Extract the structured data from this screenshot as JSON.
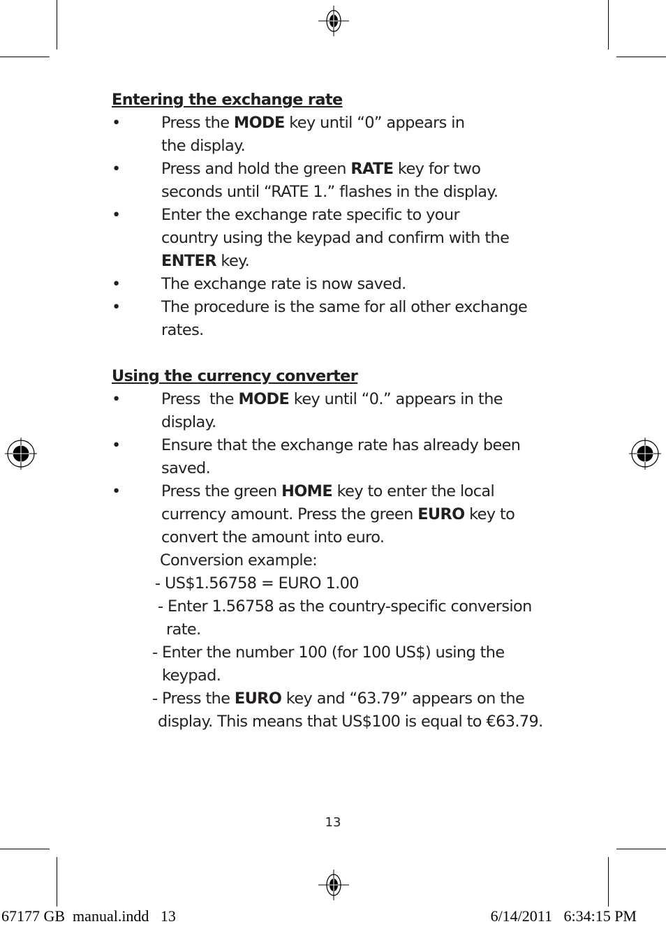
{
  "section1": {
    "heading": "Entering the exchange rate",
    "bullet_glyph": "•",
    "items": [
      {
        "pre": "Press the ",
        "bold": "MODE",
        "post": " key until “0” appears in",
        "line2": "the display."
      },
      {
        "pre": "Press and hold the green ",
        "bold": "RATE",
        "post": " key for two",
        "line2": "seconds until “RATE 1.” flashes in the display."
      },
      {
        "pre": "Enter the exchange rate specific to your",
        "line2": "country using the keypad and confirm with the",
        "bold3": "ENTER",
        "post3": " key."
      },
      {
        "text": "The exchange rate is now saved."
      },
      {
        "text": "The procedure is the same for all other exchange",
        "line2": "rates."
      }
    ]
  },
  "section2": {
    "heading": "Using the currency converter",
    "items": [
      {
        "pre": "Press  the ",
        "bold": "MODE",
        "post": " key until “0.” appears in the",
        "line2": "display."
      },
      {
        "text": "Ensure that the exchange rate has already been",
        "line2": "saved."
      },
      {
        "pre": "Press the green ",
        "bold": "HOME",
        "post": " key to enter the local",
        "pre2": "currency amount. Press the green ",
        "bold2": "EURO",
        "post2": " key to",
        "line3": "convert the amount into euro."
      }
    ],
    "example": {
      "title": "Conversion example:",
      "line1": "- US$1.56758 = EURO 1.00",
      "line2a": "- Enter 1.56758 as the country-specific conversion",
      "line2b": "rate.",
      "line3a": "- Enter the number 100 (for 100 US$) using the",
      "line3b": "keypad.",
      "line4_pre": "- Press the ",
      "line4_bold": "EURO",
      "line4_post": " key and “63.79” appears on the",
      "line4b": "display. This means that US$100 is equal to €63.79."
    }
  },
  "footer": {
    "page_number": "13",
    "slug_left": "67177 GB  manual.indd   13",
    "slug_right": "6/14/2011   6:34:15 PM"
  },
  "marks": {
    "registration_icon": "registration-target-icon",
    "crop_icon": "crop-mark-icon"
  }
}
